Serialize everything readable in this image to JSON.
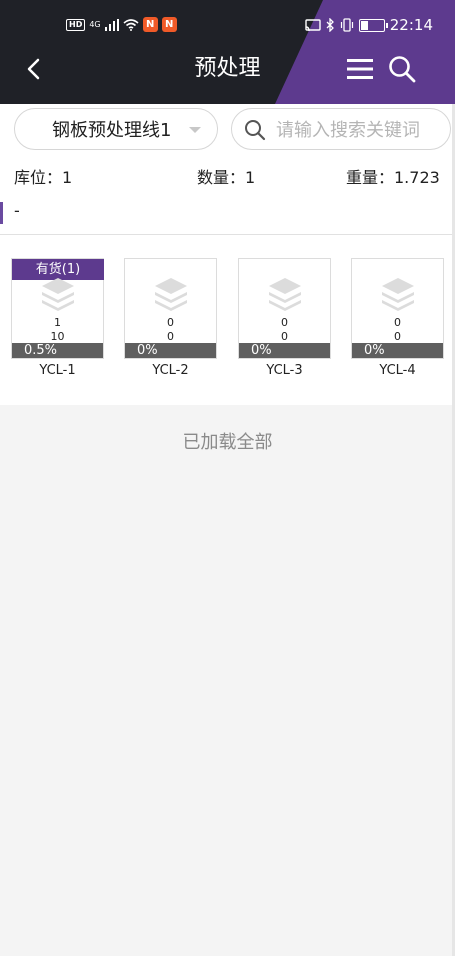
{
  "status_bar": {
    "network": "4G",
    "hd": "HD",
    "time": "22:14"
  },
  "nav": {
    "title": "预处理"
  },
  "filter": {
    "line_selected": "钢板预处理线1",
    "search_placeholder": "请输入搜索关键词"
  },
  "summary": {
    "location": "库位：1",
    "quantity": "数量：1",
    "weight": "重量：1.723"
  },
  "group": {
    "label": "-"
  },
  "slots": [
    {
      "tag": "有货(1)",
      "v1": "1",
      "v2": "10",
      "fill": "0.5%",
      "name": "YCL-1"
    },
    {
      "tag": "",
      "v1": "0",
      "v2": "0",
      "fill": "0%",
      "name": "YCL-2"
    },
    {
      "tag": "",
      "v1": "0",
      "v2": "0",
      "fill": "0%",
      "name": "YCL-3"
    },
    {
      "tag": "",
      "v1": "0",
      "v2": "0",
      "fill": "0%",
      "name": "YCL-4"
    }
  ],
  "footer": {
    "loaded_all": "已加载全部"
  },
  "colors": {
    "header_dark": "#1f2127",
    "accent_purple": "#5d3a8e",
    "bar_gray": "#5f5f5f"
  }
}
